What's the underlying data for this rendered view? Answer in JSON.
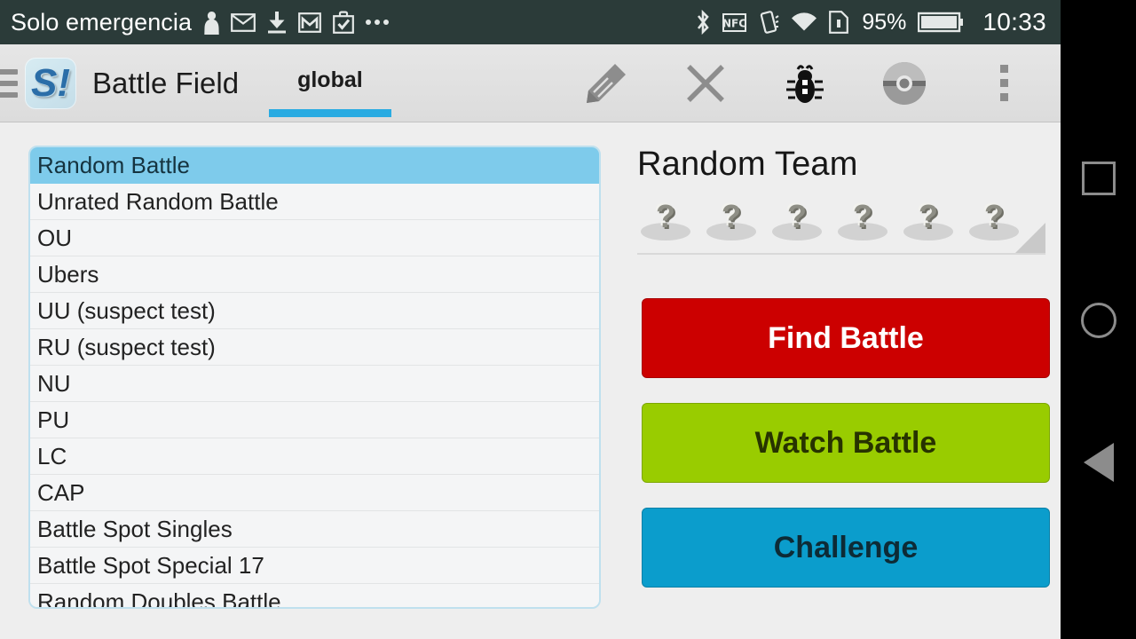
{
  "status_bar": {
    "carrier": "Solo emergencia",
    "left_icons": [
      "person-icon",
      "envelope-icon",
      "download-icon",
      "gmail-icon",
      "briefcase-check-icon",
      "more-dots-icon"
    ],
    "right_icons": [
      "bluetooth-icon",
      "nfc-icon",
      "vibrate-icon",
      "wifi-icon",
      "sim-card-icon"
    ],
    "battery_percent": "95%",
    "clock": "10:33",
    "background_color": "#2b3b39"
  },
  "app_bar": {
    "menu_icon": "hamburger-icon",
    "app_icon": "showdown-logo-icon",
    "app_icon_glyph": "S!",
    "title": "Battle Field",
    "tabs": [
      {
        "label": "global",
        "active": true
      }
    ],
    "actions": [
      {
        "name": "edit-icon"
      },
      {
        "name": "close-icon"
      },
      {
        "name": "bug-icon"
      },
      {
        "name": "pokeball-icon"
      },
      {
        "name": "overflow-menu-icon"
      }
    ],
    "accent_color": "#29abe2"
  },
  "format_list": {
    "selected_index": 0,
    "items": [
      {
        "label": "Random Battle"
      },
      {
        "label": "Unrated Random Battle"
      },
      {
        "label": "OU"
      },
      {
        "label": "Ubers"
      },
      {
        "label": "UU (suspect test)"
      },
      {
        "label": "RU (suspect test)"
      },
      {
        "label": "NU"
      },
      {
        "label": "PU"
      },
      {
        "label": "LC"
      },
      {
        "label": "CAP"
      },
      {
        "label": "Battle Spot Singles"
      },
      {
        "label": "Battle Spot Special 17"
      },
      {
        "label": "Random Doubles Battle"
      }
    ],
    "border_color": "#bfe0ee",
    "selected_color": "#7ecbeb"
  },
  "team_panel": {
    "title": "Random Team",
    "slots": [
      {
        "icon": "pokemon-placeholder-icon",
        "glyph": "?"
      },
      {
        "icon": "pokemon-placeholder-icon",
        "glyph": "?"
      },
      {
        "icon": "pokemon-placeholder-icon",
        "glyph": "?"
      },
      {
        "icon": "pokemon-placeholder-icon",
        "glyph": "?"
      },
      {
        "icon": "pokemon-placeholder-icon",
        "glyph": "?"
      },
      {
        "icon": "pokemon-placeholder-icon",
        "glyph": "?"
      }
    ]
  },
  "actions": {
    "find_battle": {
      "label": "Find Battle",
      "color": "#cc0000",
      "text_color": "#ffffff"
    },
    "watch_battle": {
      "label": "Watch Battle",
      "color": "#99cc00",
      "text_color": "#273300"
    },
    "challenge": {
      "label": "Challenge",
      "color": "#0b9dcc",
      "text_color": "#0d2b36"
    }
  },
  "nav_bar": {
    "buttons": [
      {
        "name": "recents-button",
        "icon": "square-icon"
      },
      {
        "name": "home-button",
        "icon": "circle-icon"
      },
      {
        "name": "back-button",
        "icon": "triangle-left-icon"
      }
    ]
  }
}
